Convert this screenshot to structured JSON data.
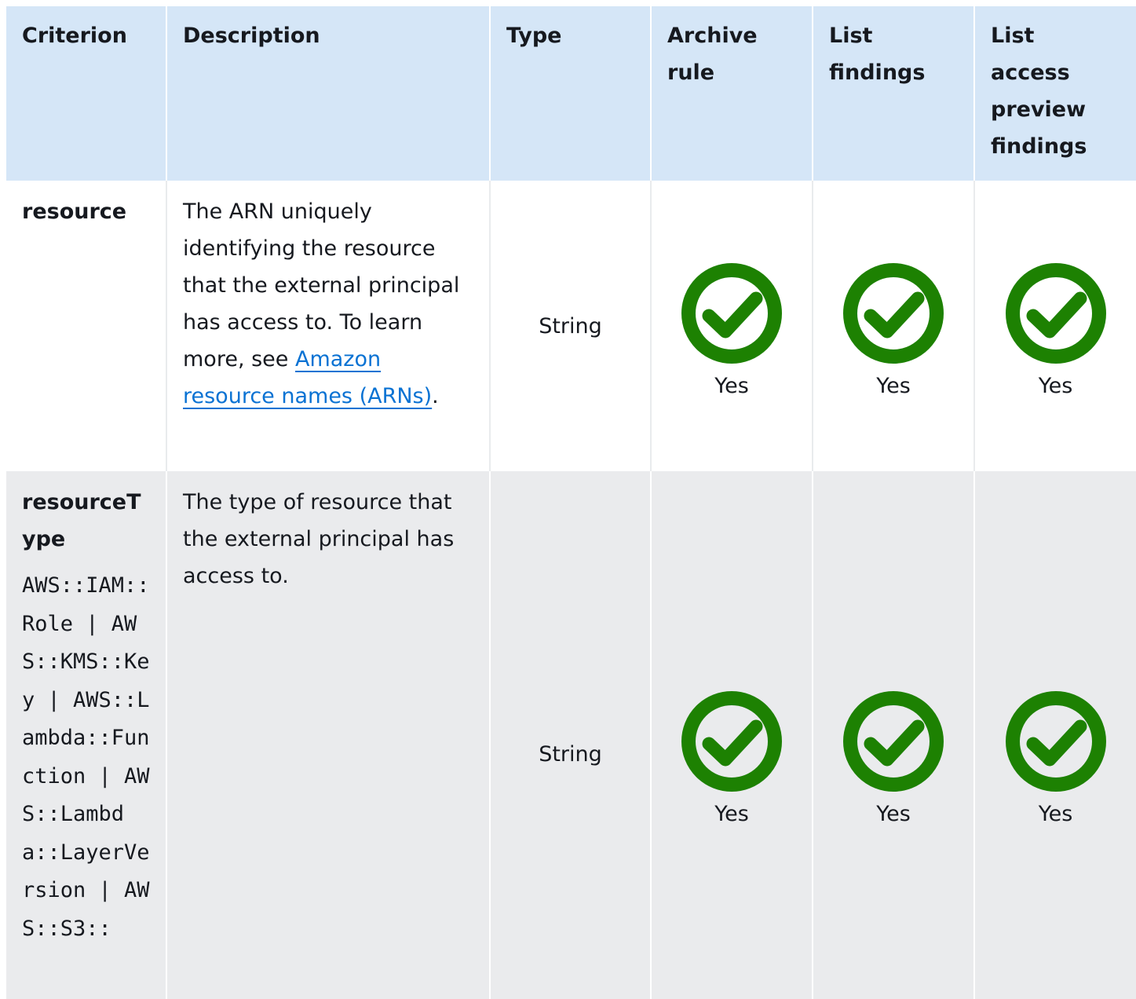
{
  "table": {
    "headers": [
      "Criterion",
      "Description",
      "Type",
      "Archive rule",
      "List findings",
      "List access preview findings"
    ],
    "rows": [
      {
        "criterion": "resource",
        "criterion_values": "",
        "description_text": "The ARN uniquely identifying the resource that the external principal has access to. To learn more, see ",
        "description_link": "Amazon resource names (ARNs)",
        "description_suffix": ".",
        "type": "String",
        "archive_rule": "Yes",
        "list_findings": "Yes",
        "list_access_preview_findings": "Yes"
      },
      {
        "criterion": "resourceType",
        "criterion_values": "AWS::IAM::Role | AWS::KMS::Key | AWS::Lambda::Function | AWS::Lambda::LayerVersion | AWS::S3::",
        "description_text": "The type of resource that the external principal has access to.",
        "description_link": "",
        "description_suffix": "",
        "type": "String",
        "archive_rule": "Yes",
        "list_findings": "Yes",
        "list_access_preview_findings": "Yes"
      }
    ]
  },
  "icons": {
    "check": "check-circle-icon"
  },
  "colors": {
    "header_bg": "#d5e6f7",
    "alt_row_bg": "#eaebed",
    "check_green": "#1d8102",
    "link": "#0972d3"
  }
}
